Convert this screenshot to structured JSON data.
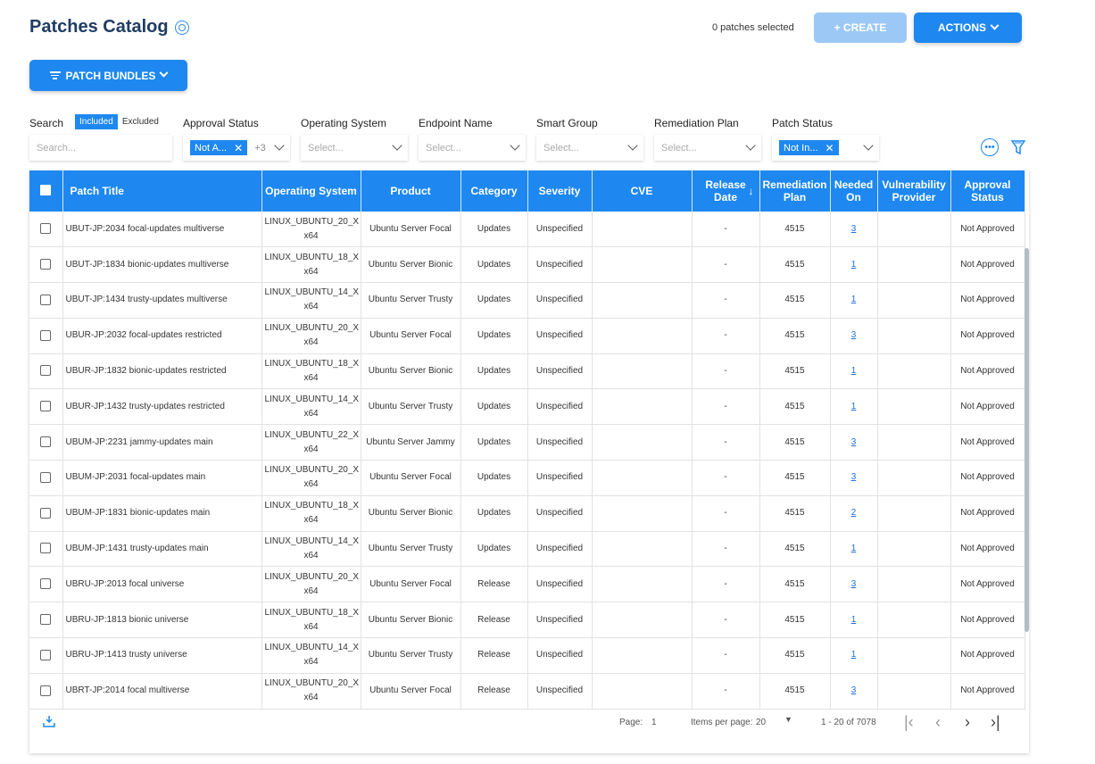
{
  "header": {
    "title": "Patches Catalog",
    "selected_count": "0 patches selected",
    "create_label": "+ CREATE",
    "actions_label": "ACTIONS",
    "bundles_label": "PATCH BUNDLES"
  },
  "filters": {
    "search_label": "Search",
    "included": "Included",
    "excluded": "Excluded",
    "search_placeholder": "Search...",
    "approval_label": "Approval Status",
    "approval_chip": "Not A...",
    "approval_more": "+3",
    "os_label": "Operating System",
    "os_placeholder": "Select...",
    "endpoint_label": "Endpoint Name",
    "endpoint_placeholder": "Select...",
    "smart_group_label": "Smart Group",
    "smart_group_placeholder": "Select...",
    "remediation_label": "Remediation Plan",
    "remediation_placeholder": "Select...",
    "status_label": "Patch Status",
    "status_chip": "Not In..."
  },
  "columns": {
    "title": "Patch Title",
    "os": "Operating System",
    "product": "Product",
    "category": "Category",
    "severity": "Severity",
    "cve": "CVE",
    "release": "Release Date",
    "plan": "Remediation Plan",
    "needed": "Needed On",
    "vuln": "Vulnerability Provider",
    "approval": "Approval Status"
  },
  "rows": [
    {
      "title": "UBUT-JP:2034 focal-updates multiverse",
      "os": "LINUX_UBUNTU_20_X x64",
      "product": "Ubuntu Server Focal",
      "category": "Updates",
      "severity": "Unspecified",
      "cve": "",
      "release": "-",
      "plan": "4515",
      "needed": "3",
      "vuln": "",
      "approval": "Not Approved"
    },
    {
      "title": "UBUT-JP:1834 bionic-updates multiverse",
      "os": "LINUX_UBUNTU_18_X x64",
      "product": "Ubuntu Server Bionic",
      "category": "Updates",
      "severity": "Unspecified",
      "cve": "",
      "release": "-",
      "plan": "4515",
      "needed": "1",
      "vuln": "",
      "approval": "Not Approved"
    },
    {
      "title": "UBUT-JP:1434 trusty-updates multiverse",
      "os": "LINUX_UBUNTU_14_X x64",
      "product": "Ubuntu Server Trusty",
      "category": "Updates",
      "severity": "Unspecified",
      "cve": "",
      "release": "-",
      "plan": "4515",
      "needed": "1",
      "vuln": "",
      "approval": "Not Approved"
    },
    {
      "title": "UBUR-JP:2032 focal-updates restricted",
      "os": "LINUX_UBUNTU_20_X x64",
      "product": "Ubuntu Server Focal",
      "category": "Updates",
      "severity": "Unspecified",
      "cve": "",
      "release": "-",
      "plan": "4515",
      "needed": "3",
      "vuln": "",
      "approval": "Not Approved"
    },
    {
      "title": "UBUR-JP:1832 bionic-updates restricted",
      "os": "LINUX_UBUNTU_18_X x64",
      "product": "Ubuntu Server Bionic",
      "category": "Updates",
      "severity": "Unspecified",
      "cve": "",
      "release": "-",
      "plan": "4515",
      "needed": "1",
      "vuln": "",
      "approval": "Not Approved"
    },
    {
      "title": "UBUR-JP:1432 trusty-updates restricted",
      "os": "LINUX_UBUNTU_14_X x64",
      "product": "Ubuntu Server Trusty",
      "category": "Updates",
      "severity": "Unspecified",
      "cve": "",
      "release": "-",
      "plan": "4515",
      "needed": "1",
      "vuln": "",
      "approval": "Not Approved"
    },
    {
      "title": "UBUM-JP:2231 jammy-updates main",
      "os": "LINUX_UBUNTU_22_X x64",
      "product": "Ubuntu Server Jammy",
      "category": "Updates",
      "severity": "Unspecified",
      "cve": "",
      "release": "-",
      "plan": "4515",
      "needed": "3",
      "vuln": "",
      "approval": "Not Approved"
    },
    {
      "title": "UBUM-JP:2031 focal-updates main",
      "os": "LINUX_UBUNTU_20_X x64",
      "product": "Ubuntu Server Focal",
      "category": "Updates",
      "severity": "Unspecified",
      "cve": "",
      "release": "-",
      "plan": "4515",
      "needed": "3",
      "vuln": "",
      "approval": "Not Approved"
    },
    {
      "title": "UBUM-JP:1831 bionic-updates main",
      "os": "LINUX_UBUNTU_18_X x64",
      "product": "Ubuntu Server Bionic",
      "category": "Updates",
      "severity": "Unspecified",
      "cve": "",
      "release": "-",
      "plan": "4515",
      "needed": "2",
      "vuln": "",
      "approval": "Not Approved"
    },
    {
      "title": "UBUM-JP:1431 trusty-updates main",
      "os": "LINUX_UBUNTU_14_X x64",
      "product": "Ubuntu Server Trusty",
      "category": "Updates",
      "severity": "Unspecified",
      "cve": "",
      "release": "-",
      "plan": "4515",
      "needed": "1",
      "vuln": "",
      "approval": "Not Approved"
    },
    {
      "title": "UBRU-JP:2013 focal universe",
      "os": "LINUX_UBUNTU_20_X x64",
      "product": "Ubuntu Server Focal",
      "category": "Release",
      "severity": "Unspecified",
      "cve": "",
      "release": "-",
      "plan": "4515",
      "needed": "3",
      "vuln": "",
      "approval": "Not Approved"
    },
    {
      "title": "UBRU-JP:1813 bionic universe",
      "os": "LINUX_UBUNTU_18_X x64",
      "product": "Ubuntu Server Bionic",
      "category": "Release",
      "severity": "Unspecified",
      "cve": "",
      "release": "-",
      "plan": "4515",
      "needed": "1",
      "vuln": "",
      "approval": "Not Approved"
    },
    {
      "title": "UBRU-JP:1413 trusty universe",
      "os": "LINUX_UBUNTU_14_X x64",
      "product": "Ubuntu Server Trusty",
      "category": "Release",
      "severity": "Unspecified",
      "cve": "",
      "release": "-",
      "plan": "4515",
      "needed": "1",
      "vuln": "",
      "approval": "Not Approved"
    },
    {
      "title": "UBRT-JP:2014 focal multiverse",
      "os": "LINUX_UBUNTU_20_X x64",
      "product": "Ubuntu Server Focal",
      "category": "Release",
      "severity": "Unspecified",
      "cve": "",
      "release": "-",
      "plan": "4515",
      "needed": "3",
      "vuln": "",
      "approval": "Not Approved"
    }
  ],
  "pager": {
    "page_label": "Page:",
    "page_value": "1",
    "items_label": "Items per page:",
    "items_value": "20",
    "range": "1 - 20 of 7078"
  },
  "colors": {
    "primary": "#1e88f0",
    "primary_disabled": "#9cc8f5",
    "title": "#1f3c63"
  },
  "icons": [
    "help-icon",
    "chevron-down-icon",
    "filter-lines-icon",
    "close-icon",
    "more-options-icon",
    "funnel-icon",
    "download-icon",
    "sort-arrow-icon",
    "first-page-icon",
    "prev-page-icon",
    "next-page-icon",
    "last-page-icon"
  ]
}
